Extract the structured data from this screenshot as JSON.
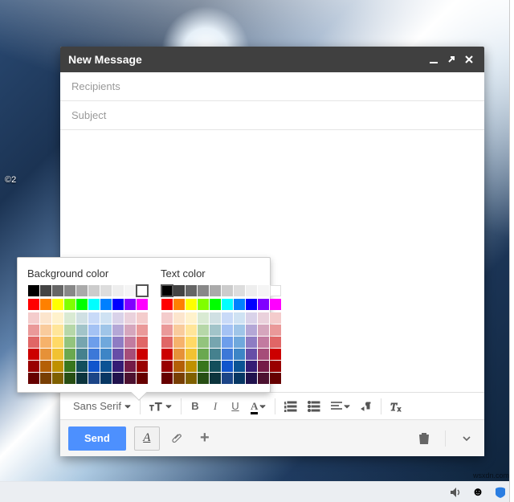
{
  "bg": {
    "copyright_prefix": "©2"
  },
  "compose": {
    "title": "New Message",
    "window_controls": {
      "minimize": "minimize",
      "expand": "expand",
      "close": "close"
    },
    "recipients": {
      "placeholder": "Recipients",
      "value": ""
    },
    "subject": {
      "placeholder": "Subject",
      "value": ""
    },
    "body": {
      "value": ""
    }
  },
  "format_toolbar": {
    "font_family": {
      "label": "Sans Serif"
    },
    "font_size_label": "T",
    "bold": "B",
    "italic": "I",
    "underline": "U",
    "text_color": "A",
    "numbered_list": "numbered-list",
    "bulleted_list": "bulleted-list",
    "align": "align",
    "indent_rtl": "indent-rtl",
    "clear_formatting_label": "Tx"
  },
  "send_bar": {
    "send_label": "Send",
    "format_toggle_label": "A",
    "attach": "attach",
    "insert_more": "+",
    "discard": "trash",
    "more": "more"
  },
  "color_picker": {
    "headings": {
      "bg": "Background color",
      "text": "Text color"
    },
    "bg_selected": "#ffffff",
    "text_selected": "#000000",
    "rows": [
      [
        "#000000",
        "#444444",
        "#666666",
        "#888888",
        "#aaaaaa",
        "#cccccc",
        "#dddddd",
        "#eeeeee",
        "#f5f5f5",
        "#ffffff"
      ],
      "gap",
      [
        "#ff0000",
        "#ff8000",
        "#ffff00",
        "#80ff00",
        "#00ff00",
        "#00ffff",
        "#0080ff",
        "#0000ff",
        "#8000ff",
        "#ff00ff"
      ],
      "gap",
      [
        "#f4cccc",
        "#fce5cd",
        "#fff2cc",
        "#d9ead3",
        "#d0e0e3",
        "#c9daf8",
        "#cfe2f3",
        "#d9d2e9",
        "#ead1dc",
        "#f4cccc"
      ],
      [
        "#ea9999",
        "#f9cb9c",
        "#ffe599",
        "#b6d7a8",
        "#a2c4c9",
        "#a4c2f4",
        "#9fc5e8",
        "#b4a7d6",
        "#d5a6bd",
        "#ea9999"
      ],
      [
        "#e06666",
        "#f6b26b",
        "#ffd966",
        "#93c47d",
        "#76a5af",
        "#6d9eeb",
        "#6fa8dc",
        "#8e7cc3",
        "#c27ba0",
        "#e06666"
      ],
      [
        "#cc0000",
        "#e69138",
        "#f1c232",
        "#6aa84f",
        "#45818e",
        "#3c78d8",
        "#3d85c6",
        "#674ea7",
        "#a64d79",
        "#cc0000"
      ],
      [
        "#990000",
        "#b45f06",
        "#bf9000",
        "#38761d",
        "#134f5c",
        "#1155cc",
        "#0b5394",
        "#351c75",
        "#741b47",
        "#990000"
      ],
      [
        "#660000",
        "#783f04",
        "#7f6000",
        "#274e13",
        "#0c343d",
        "#1c4587",
        "#073763",
        "#20124d",
        "#4c1130",
        "#660000"
      ]
    ]
  },
  "taskbar": {
    "audio": "audio",
    "emoji": "emoji",
    "brand": "brand"
  },
  "attribution": "wsxdn.com"
}
